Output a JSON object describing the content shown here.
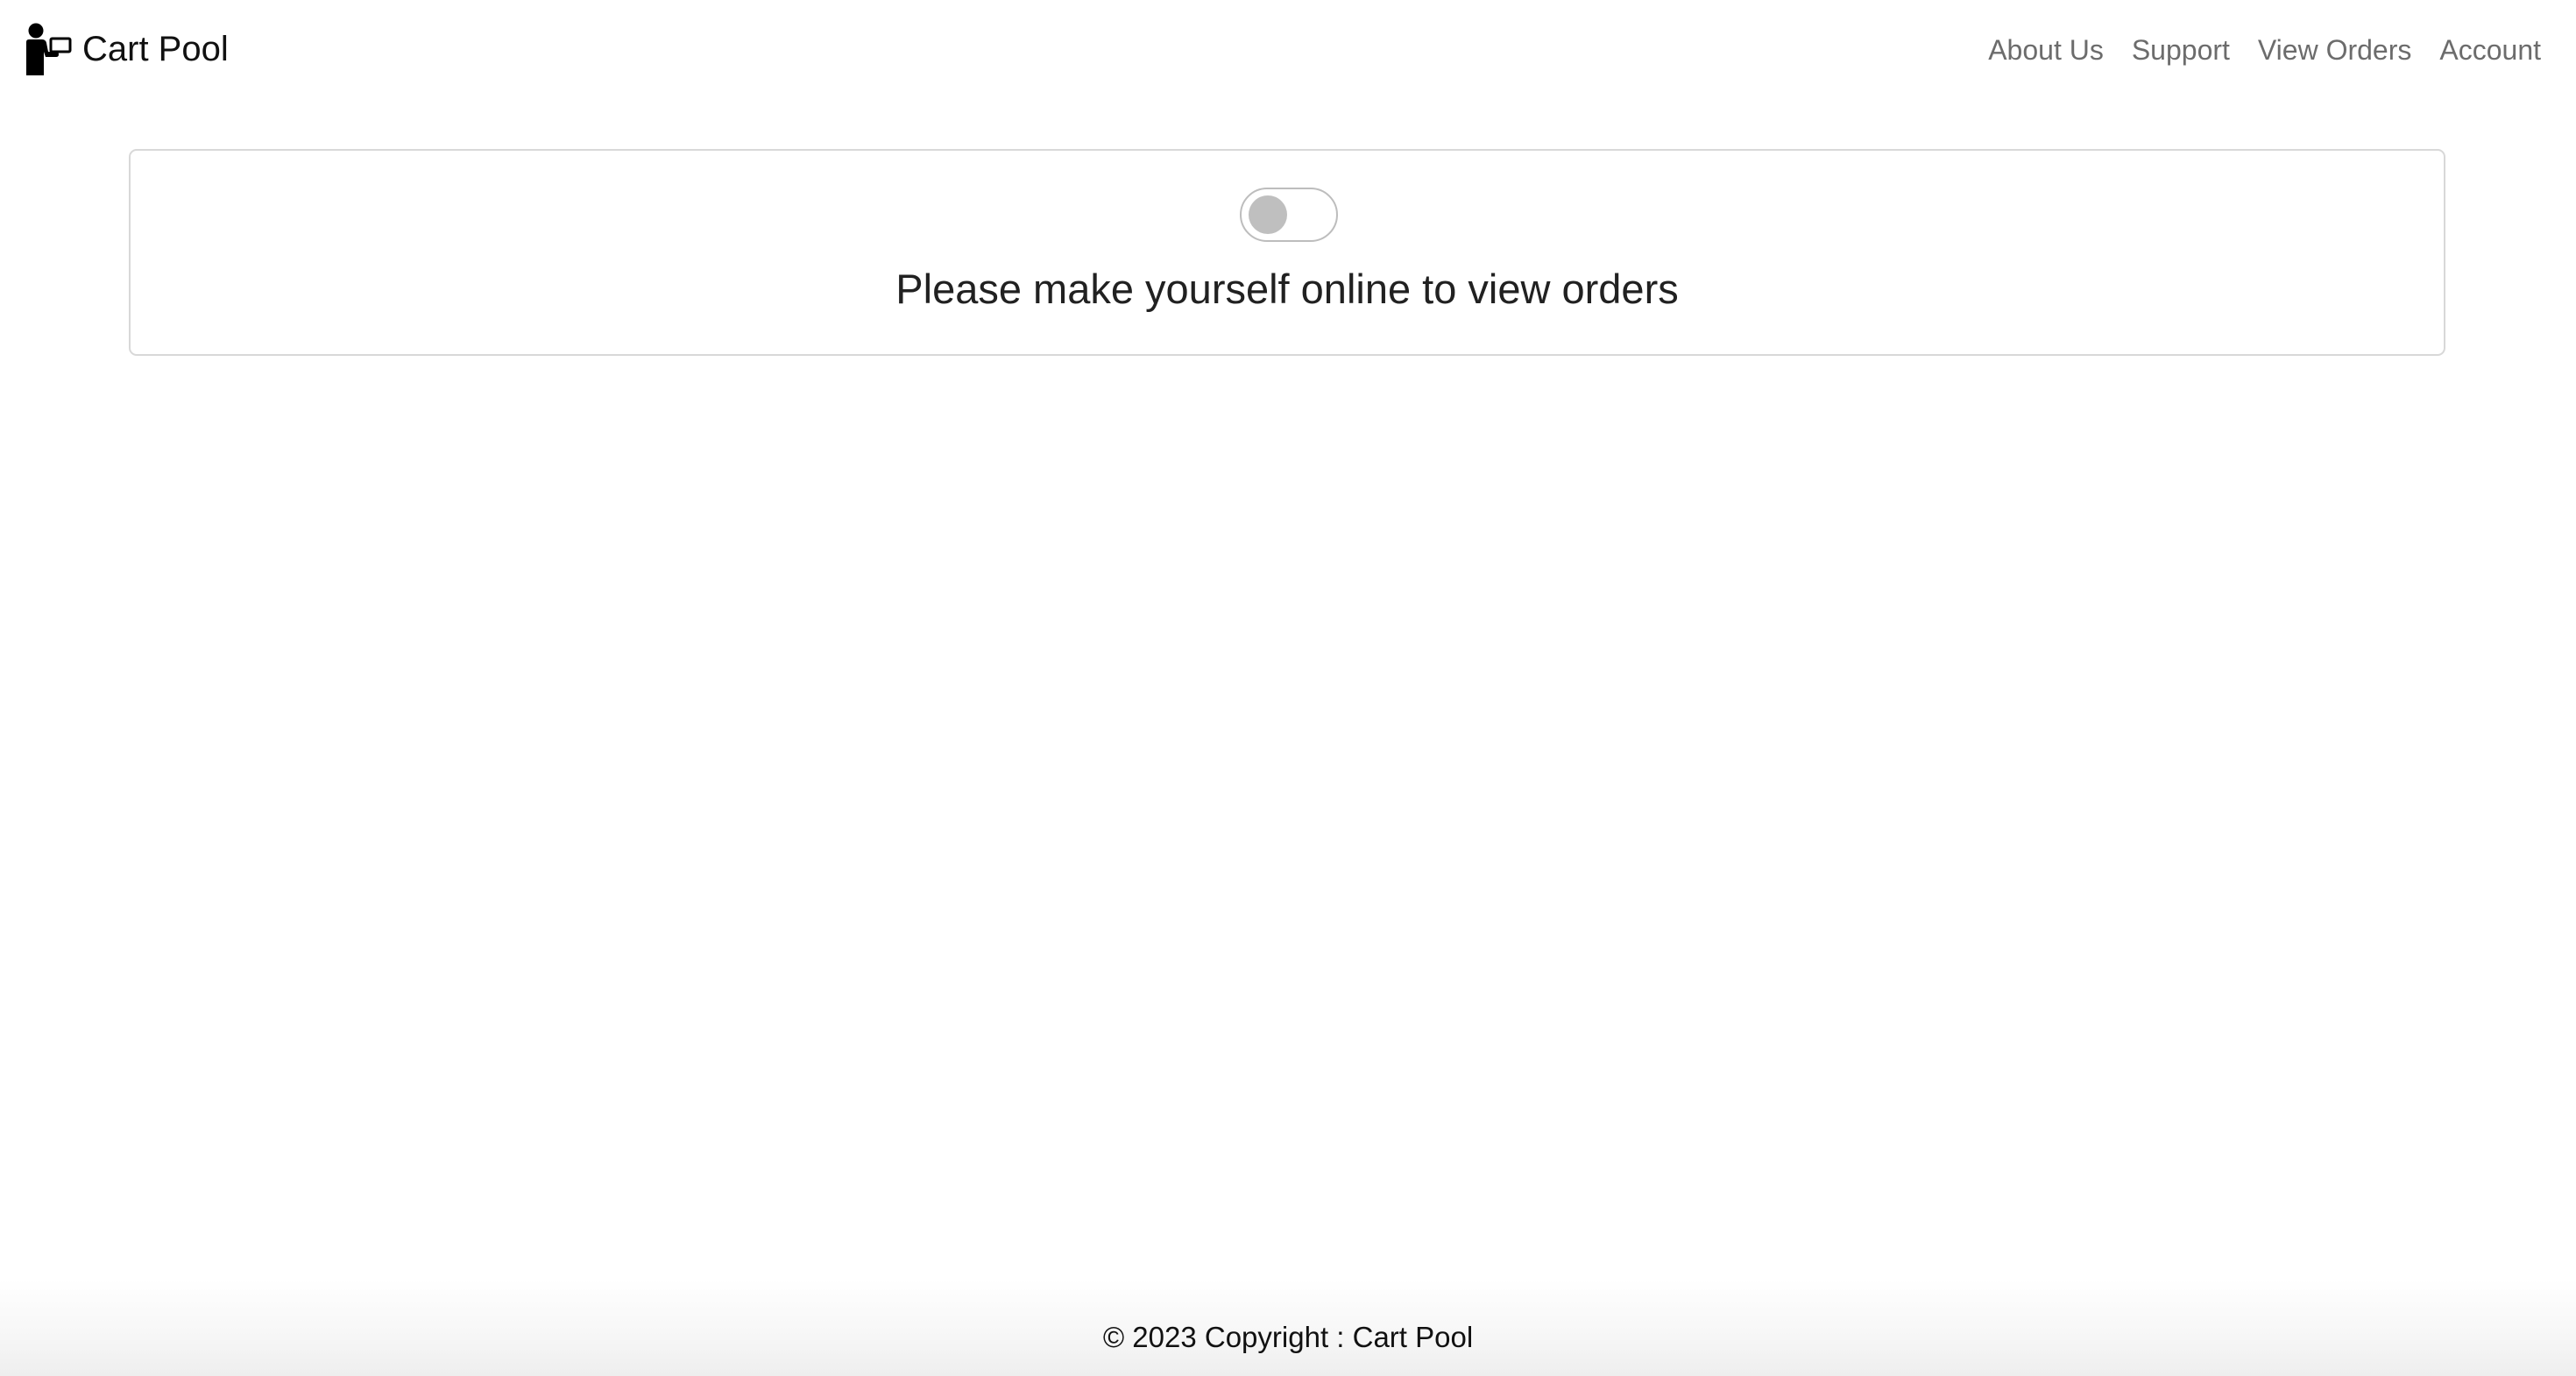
{
  "brand": {
    "name": "Cart Pool",
    "logo_icon": "delivery-person-icon"
  },
  "nav": {
    "items": [
      {
        "label": "About Us"
      },
      {
        "label": "Support"
      },
      {
        "label": "View Orders"
      },
      {
        "label": "Account"
      }
    ]
  },
  "status_card": {
    "toggle_state": "off",
    "message": "Please make yourself online to view orders"
  },
  "footer": {
    "copyright": "© 2023 Copyright : Cart Pool"
  },
  "colors": {
    "nav_link": "#6c6c6c",
    "toggle_knob_off": "#bfbfbf",
    "card_border": "#d8d8d8"
  }
}
